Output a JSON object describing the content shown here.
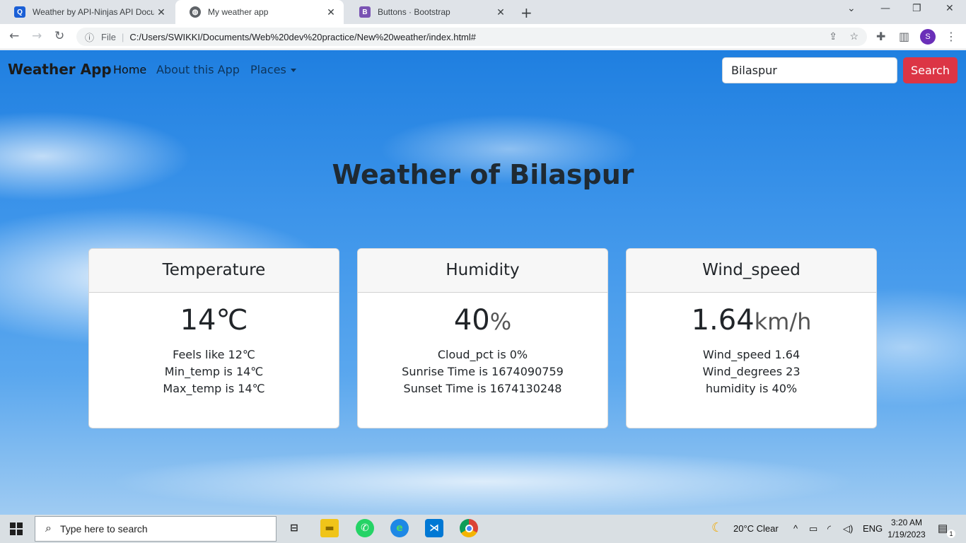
{
  "browser": {
    "tabs": [
      {
        "title": "Weather by API-Ninjas API Docum",
        "icon": "api-ninjas-icon"
      },
      {
        "title": "My weather app",
        "icon": "globe-icon"
      },
      {
        "title": "Buttons · Bootstrap",
        "icon": "bootstrap-icon"
      }
    ],
    "file_label": "File",
    "url": "C:/Users/SWIKKI/Documents/Web%20dev%20practice/New%20weather/index.html#",
    "profile_initial": "S"
  },
  "navbar": {
    "brand": "Weather App",
    "links": [
      "Home",
      "About this App",
      "Places"
    ],
    "search_value": "Bilaspur",
    "search_button": "Search"
  },
  "headline": "Weather of Bilaspur",
  "cards": [
    {
      "title": "Temperature",
      "value": "14℃",
      "unit": "",
      "lines": [
        "Feels like 12℃",
        "Min_temp is 14℃",
        "Max_temp is 14℃"
      ]
    },
    {
      "title": "Humidity",
      "value": "40",
      "unit": "%",
      "lines": [
        "Cloud_pct is 0%",
        "Sunrise Time is 1674090759",
        "Sunset Time is 1674130248"
      ]
    },
    {
      "title": "Wind_speed",
      "value": "1.64",
      "unit": "km/h",
      "lines": [
        "Wind_speed 1.64",
        "Wind_degrees 23",
        "humidity is 40%"
      ]
    }
  ],
  "taskbar": {
    "search_placeholder": "Type here to search",
    "weather": "20°C  Clear",
    "lang": "ENG",
    "time": "3:20 AM",
    "date": "1/19/2023",
    "notifications": "1"
  },
  "colors": {
    "search_button": "#dc3545",
    "sky": "#3c94ea"
  }
}
